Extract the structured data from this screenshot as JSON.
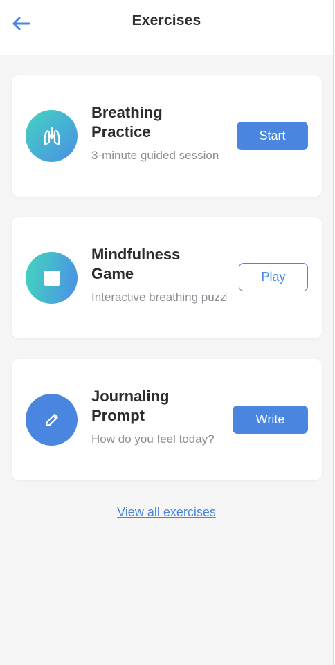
{
  "header": {
    "title": "Exercises",
    "back_icon": "arrow-left-icon"
  },
  "colors": {
    "accent": "#4a86e0",
    "gradient_start": "#43d3c0",
    "background": "#f5f5f6"
  },
  "exercises": [
    {
      "title": "Breathing Practice",
      "subtitle": "3-minute guided session",
      "button_label": "Start",
      "button_style": "solid",
      "icon": "lungs-icon"
    },
    {
      "title": "Mindfulness Game",
      "subtitle": "Interactive breathing puzzle",
      "button_label": "Play",
      "button_style": "outline",
      "icon": "square-icon"
    },
    {
      "title": "Journaling Prompt",
      "subtitle": "How do you feel today?",
      "button_label": "Write",
      "button_style": "solid",
      "icon": "pencil-icon"
    }
  ],
  "footer": {
    "view_all_label": "View all exercises"
  }
}
